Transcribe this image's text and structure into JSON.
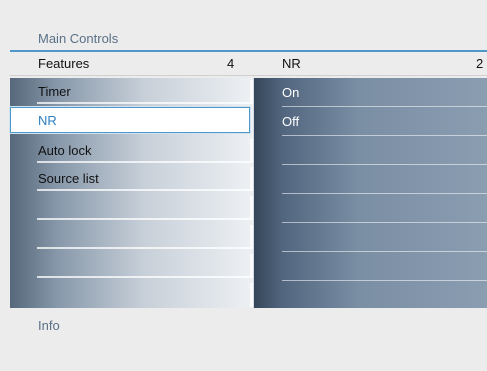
{
  "breadcrumb": "Main Controls",
  "header": {
    "left_title": "Features",
    "left_count": "4",
    "right_title": "NR",
    "right_count": "2"
  },
  "left_menu": {
    "items": [
      {
        "label": "Timer"
      },
      {
        "label": "NR"
      },
      {
        "label": "Auto lock"
      },
      {
        "label": "Source list"
      },
      {
        "label": ""
      },
      {
        "label": ""
      },
      {
        "label": ""
      },
      {
        "label": ""
      }
    ],
    "selected_item": "NR"
  },
  "right_menu": {
    "items": [
      {
        "label": "On"
      },
      {
        "label": "Off"
      },
      {
        "label": ""
      },
      {
        "label": ""
      },
      {
        "label": ""
      },
      {
        "label": ""
      },
      {
        "label": ""
      },
      {
        "label": ""
      }
    ]
  },
  "footer": {
    "info_label": "Info"
  },
  "colors": {
    "accent": "#4f97c9",
    "selected_text": "#2f7fc1",
    "panel_background": "#ececec"
  }
}
